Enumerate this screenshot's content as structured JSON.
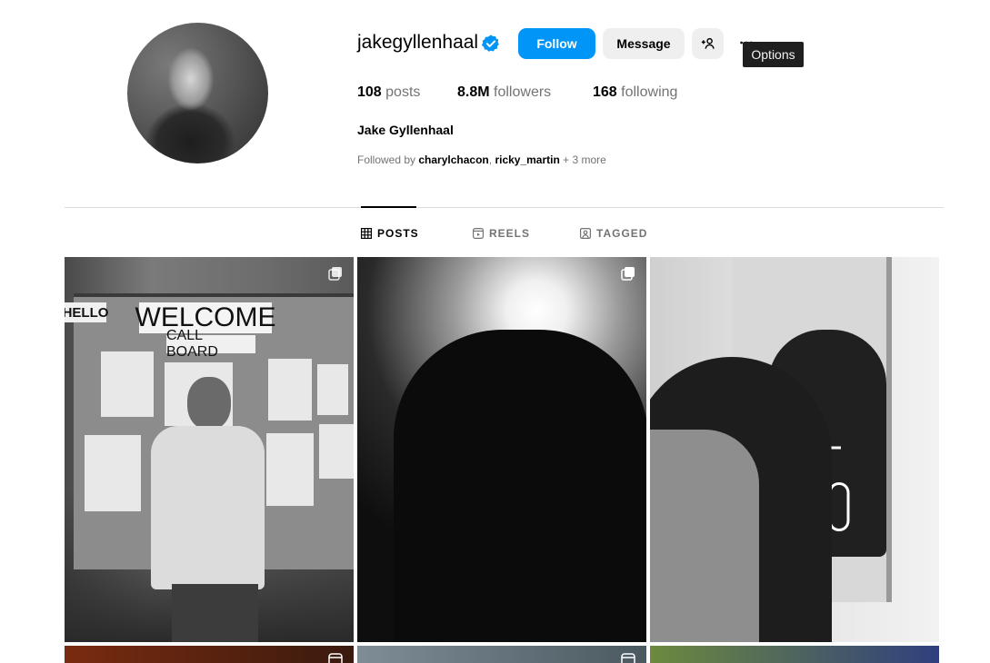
{
  "profile": {
    "username": "jakegyllenhaal",
    "verified": true,
    "full_name": "Jake Gyllenhaal",
    "stats": {
      "posts_count": "108",
      "posts_label": "posts",
      "followers_count": "8.8M",
      "followers_label": "followers",
      "following_count": "168",
      "following_label": "following"
    },
    "followed_by": {
      "prefix": "Followed by",
      "user1": "charylchacon",
      "separator": ",",
      "user2": "ricky_martin",
      "more": "+ 3 more"
    }
  },
  "actions": {
    "follow_label": "Follow",
    "message_label": "Message",
    "add_user_icon": "add-user-icon",
    "options_icon": "more-horizontal-icon",
    "options_tooltip": "Options"
  },
  "tabs": [
    {
      "label": "POSTS",
      "icon": "grid-icon",
      "active": true
    },
    {
      "label": "REELS",
      "icon": "reels-icon",
      "active": false
    },
    {
      "label": "TAGGED",
      "icon": "tagged-icon",
      "active": false
    }
  ],
  "posts": [
    {
      "type": "carousel",
      "sign_text_1": "WELCOME",
      "sign_text_2": "CALL BOARD",
      "sign_text_3": "HELLO"
    },
    {
      "type": "carousel"
    },
    {
      "type": "photo"
    },
    {
      "type": "reel"
    },
    {
      "type": "reel"
    },
    {
      "type": "photo"
    }
  ],
  "colors": {
    "accent": "#0095f6",
    "secondary_button": "#efefef",
    "muted_text": "#737373",
    "tooltip_bg": "#1f1f1f"
  }
}
